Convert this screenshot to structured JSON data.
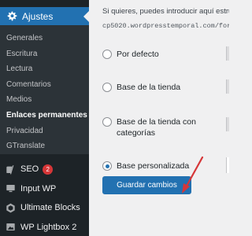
{
  "sidebar": {
    "active_menu": {
      "label": "Ajustes",
      "icon": "settings-icon"
    },
    "submenu": [
      {
        "label": "Generales"
      },
      {
        "label": "Escritura"
      },
      {
        "label": "Lectura"
      },
      {
        "label": "Comentarios"
      },
      {
        "label": "Medios"
      },
      {
        "label": "Enlaces permanentes",
        "current": true
      },
      {
        "label": "Privacidad"
      },
      {
        "label": "GTranslate"
      }
    ],
    "plugins": [
      {
        "label": "SEO",
        "icon": "yoast-icon",
        "badge": "2"
      },
      {
        "label": "Input WP",
        "icon": "monitor-icon"
      },
      {
        "label": "Ultimate Blocks",
        "icon": "hexagon-icon"
      },
      {
        "label": "WP Lightbox 2",
        "icon": "lightbox-icon"
      }
    ]
  },
  "main": {
    "intro_text": "Si quieres, puedes introducir aquí estructuras",
    "url_text": "cp5020.wordpresstemporal.com/for",
    "options": [
      {
        "label": "Por defecto",
        "checked": false
      },
      {
        "label": "Base de la tienda",
        "checked": false
      },
      {
        "label": "Base de la tienda con categorías",
        "checked": false
      },
      {
        "label": "Base personalizada",
        "checked": true
      }
    ],
    "save_label": "Guardar cambios"
  },
  "colors": {
    "accent": "#2271b1",
    "sidebar": "#1d2327",
    "submenu": "#2c3338",
    "annotation_arrow": "#d63638"
  }
}
